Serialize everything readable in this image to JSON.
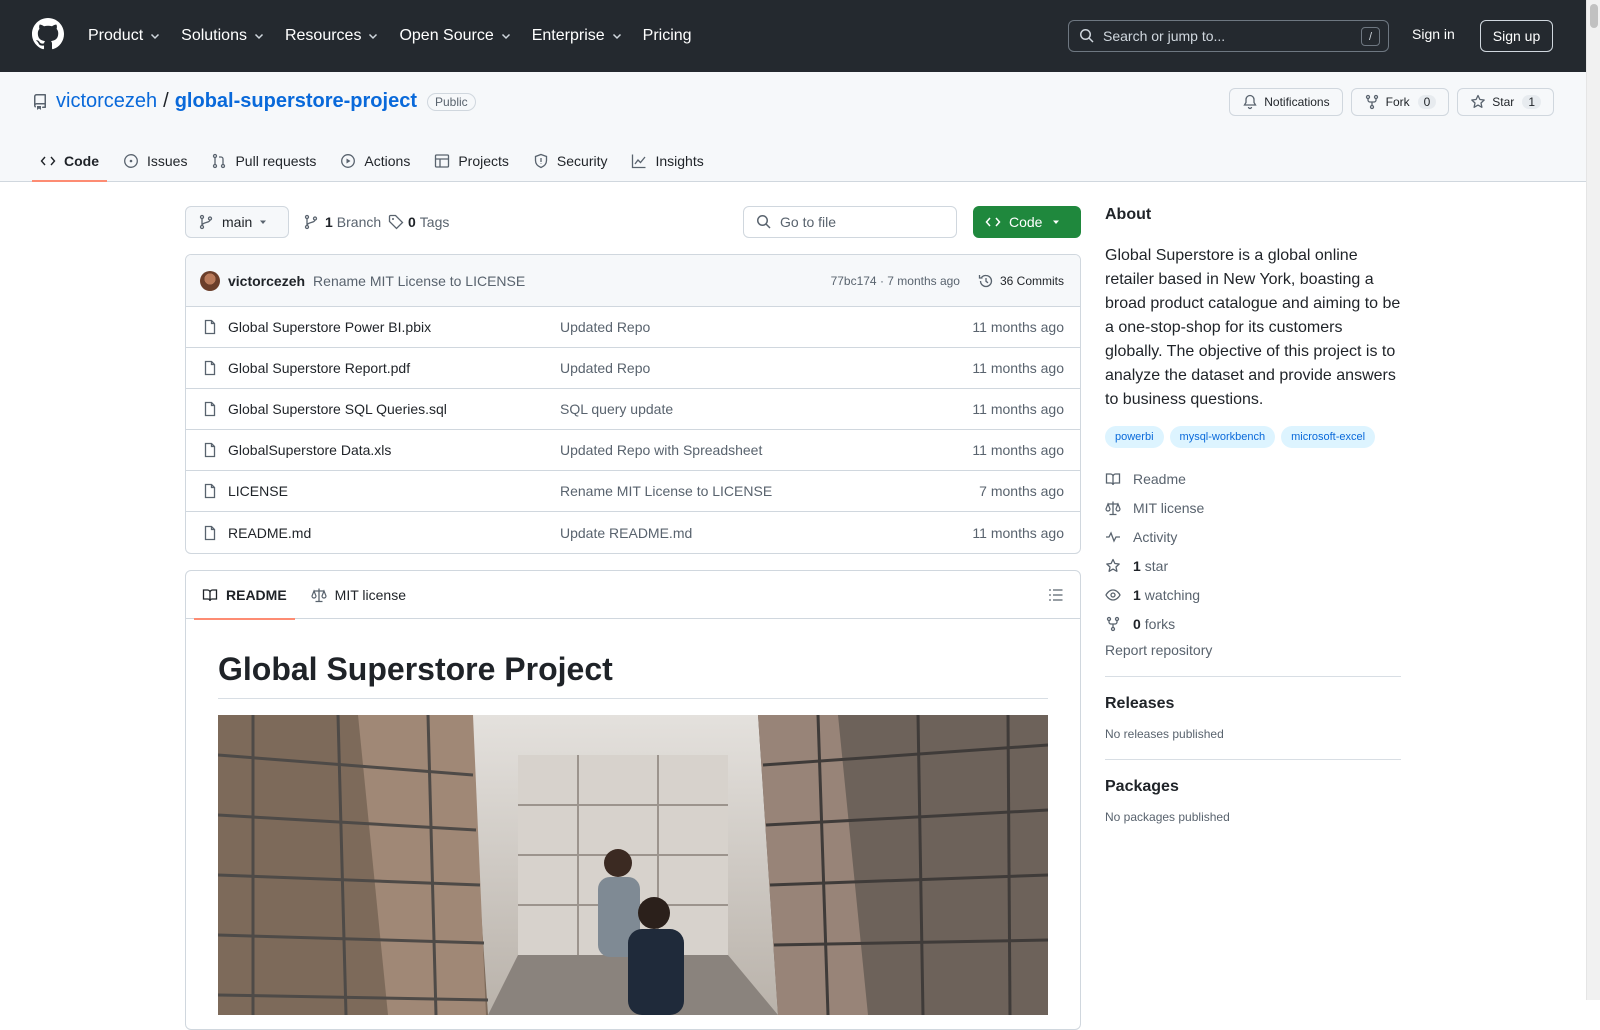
{
  "header": {
    "nav": [
      "Product",
      "Solutions",
      "Resources",
      "Open Source",
      "Enterprise",
      "Pricing"
    ],
    "search_placeholder": "Search or jump to...",
    "search_shortcut": "/",
    "sign_in": "Sign in",
    "sign_up": "Sign up"
  },
  "repo": {
    "owner": "victorcezeh",
    "separator": "/",
    "name": "global-superstore-project",
    "visibility": "Public",
    "notifications_label": "Notifications",
    "fork_label": "Fork",
    "fork_count": "0",
    "star_label": "Star",
    "star_count": "1",
    "tabs": [
      "Code",
      "Issues",
      "Pull requests",
      "Actions",
      "Projects",
      "Security",
      "Insights"
    ]
  },
  "toolbar": {
    "branch": "main",
    "branch_count": "1",
    "branch_label": "Branch",
    "tag_count": "0",
    "tag_label": "Tags",
    "goto_placeholder": "Go to file",
    "code_button": "Code"
  },
  "commit": {
    "author": "victorcezeh",
    "message": "Rename MIT License to LICENSE",
    "hash_time": "77bc174 · 7 months ago",
    "count_label": "36 Commits"
  },
  "files": [
    {
      "name": "Global Superstore Power BI.pbix",
      "message": "Updated Repo",
      "time": "11 months ago"
    },
    {
      "name": "Global Superstore Report.pdf",
      "message": "Updated Repo",
      "time": "11 months ago"
    },
    {
      "name": "Global Superstore SQL Queries.sql",
      "message": "SQL query update",
      "time": "11 months ago"
    },
    {
      "name": "GlobalSuperstore Data.xls",
      "message": "Updated Repo with Spreadsheet",
      "time": "11 months ago"
    },
    {
      "name": "LICENSE",
      "message": "Rename MIT License to LICENSE",
      "time": "7 months ago"
    },
    {
      "name": "README.md",
      "message": "Update README.md",
      "time": "11 months ago"
    }
  ],
  "readme": {
    "tab_readme": "README",
    "tab_license": "MIT license",
    "title": "Global Superstore Project"
  },
  "about": {
    "heading": "About",
    "description": "Global Superstore is a global online retailer based in New York, boasting a broad product catalogue and aiming to be a one-stop-shop for its customers globally. The objective of this project is to analyze the dataset and provide answers to business questions.",
    "topics": [
      "powerbi",
      "mysql-workbench",
      "microsoft-excel"
    ],
    "readme_link": "Readme",
    "license_link": "MIT license",
    "activity_link": "Activity",
    "stars_count": "1",
    "stars_label": "star",
    "watching_count": "1",
    "watching_label": "watching",
    "forks_count": "0",
    "forks_label": "forks",
    "report": "Report repository"
  },
  "releases": {
    "heading": "Releases",
    "empty": "No releases published"
  },
  "packages": {
    "heading": "Packages",
    "empty": "No packages published"
  },
  "colors": {
    "header_bg": "#24292f",
    "link": "#0969da",
    "primary_button": "#1f883d",
    "active_tab_underline": "#fd8c73",
    "topic_bg": "#ddf4ff"
  }
}
